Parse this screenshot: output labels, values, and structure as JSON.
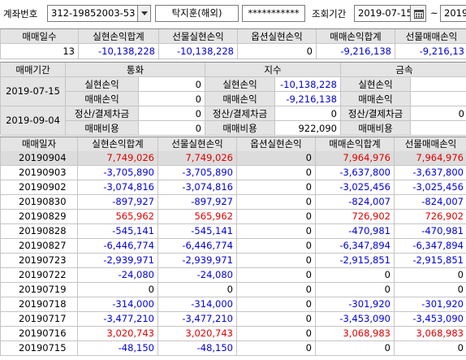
{
  "topbar": {
    "account_label": "계좌번호",
    "account_number": "312-19852003-53",
    "account_owner": "탁지훈(해외)",
    "password_mask": "***********",
    "period_label": "조회기간",
    "date_from": "2019-07-15",
    "tilde": "~",
    "date_to": "2019-0"
  },
  "summary": {
    "headers": [
      "매매일수",
      "실현손익합계",
      "선물실현손익",
      "옵션실현손익",
      "매매손익합계",
      "선물매매손익"
    ],
    "values": [
      "13",
      "-10,138,228",
      "-10,138,228",
      "0",
      "-9,216,138",
      "-9,216,13"
    ]
  },
  "detail": {
    "period_label": "매매기간",
    "date_from": "2019-07-15",
    "date_to": "2019-09-04",
    "groups": [
      "통화",
      "지수",
      "금속"
    ],
    "row_labels": [
      "실현손익",
      "매매손익",
      "정산/결제차금",
      "매매비용"
    ],
    "currency": [
      "0",
      "0",
      "0",
      "0"
    ],
    "index": [
      "-10,138,228",
      "-9,216,138",
      "0",
      "922,090"
    ],
    "metal": [
      "",
      "",
      "0",
      ""
    ]
  },
  "list": {
    "headers": [
      "매매일자",
      "실현손익합계",
      "선물실현손익",
      "옵션실현손익",
      "매매손익합계",
      "선물매매손익"
    ],
    "rows": [
      {
        "date": "20190904",
        "c1": "7,749,026",
        "c2": "7,749,026",
        "c3": "0",
        "c4": "7,964,976",
        "c5": "7,964,976",
        "sign": "pos"
      },
      {
        "date": "20190903",
        "c1": "-3,705,890",
        "c2": "-3,705,890",
        "c3": "0",
        "c4": "-3,637,800",
        "c5": "-3,637,800",
        "sign": "neg"
      },
      {
        "date": "20190902",
        "c1": "-3,074,816",
        "c2": "-3,074,816",
        "c3": "0",
        "c4": "-3,025,456",
        "c5": "-3,025,456",
        "sign": "neg"
      },
      {
        "date": "20190830",
        "c1": "-897,927",
        "c2": "-897,927",
        "c3": "0",
        "c4": "-824,007",
        "c5": "-824,007",
        "sign": "neg"
      },
      {
        "date": "20190829",
        "c1": "565,962",
        "c2": "565,962",
        "c3": "0",
        "c4": "726,902",
        "c5": "726,902",
        "sign": "pos"
      },
      {
        "date": "20190828",
        "c1": "-545,141",
        "c2": "-545,141",
        "c3": "0",
        "c4": "-470,981",
        "c5": "-470,981",
        "sign": "neg"
      },
      {
        "date": "20190827",
        "c1": "-6,446,774",
        "c2": "-6,446,774",
        "c3": "0",
        "c4": "-6,347,894",
        "c5": "-6,347,894",
        "sign": "neg"
      },
      {
        "date": "20190723",
        "c1": "-2,939,971",
        "c2": "-2,939,971",
        "c3": "0",
        "c4": "-2,915,851",
        "c5": "-2,915,851",
        "sign": "neg"
      },
      {
        "date": "20190722",
        "c1": "-24,080",
        "c2": "-24,080",
        "c3": "0",
        "c4": "0",
        "c5": "0",
        "sign": "neg"
      },
      {
        "date": "20190719",
        "c1": "0",
        "c2": "0",
        "c3": "0",
        "c4": "0",
        "c5": "0",
        "sign": "zero"
      },
      {
        "date": "20190718",
        "c1": "-314,000",
        "c2": "-314,000",
        "c3": "0",
        "c4": "-301,920",
        "c5": "-301,920",
        "sign": "neg"
      },
      {
        "date": "20190717",
        "c1": "-3,477,210",
        "c2": "-3,477,210",
        "c3": "0",
        "c4": "-3,453,090",
        "c5": "-3,453,090",
        "sign": "neg"
      },
      {
        "date": "20190716",
        "c1": "3,020,743",
        "c2": "3,020,743",
        "c3": "0",
        "c4": "3,068,983",
        "c5": "3,068,983",
        "sign": "pos"
      },
      {
        "date": "20190715",
        "c1": "-48,150",
        "c2": "-48,150",
        "c3": "0",
        "c4": "0",
        "c5": "0",
        "sign": "neg"
      }
    ]
  },
  "colors": {
    "positive": "#e00000",
    "negative": "#0000e0",
    "header_bg": "#e4e4e4",
    "selected_row_bg": "#dcdcdc"
  }
}
